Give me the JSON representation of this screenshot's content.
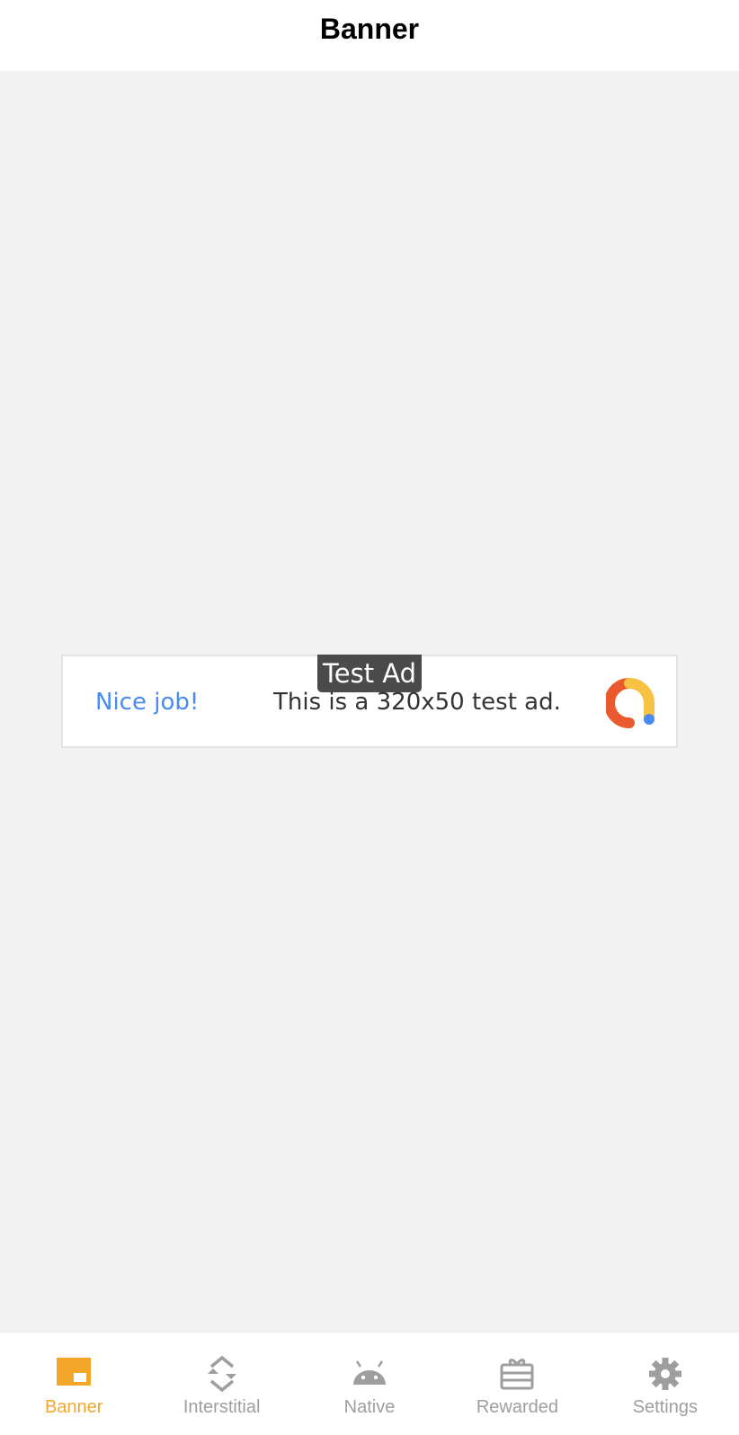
{
  "header": {
    "title": "Banner"
  },
  "ad": {
    "badge": "Test Ad",
    "headline": "Nice job!",
    "body": "This is a 320x50 test ad.",
    "colors": {
      "headline": "#4a8af4",
      "logo_red": "#ea5a2e",
      "logo_yellow": "#f7c244",
      "logo_blue": "#4a8af4"
    }
  },
  "bottom_nav": {
    "active_color": "#f4a62a",
    "inactive_color": "#9e9e9e",
    "items": [
      {
        "label": "Banner",
        "icon": "banner-icon",
        "active": true
      },
      {
        "label": "Interstitial",
        "icon": "interstitial-icon",
        "active": false
      },
      {
        "label": "Native",
        "icon": "android-icon",
        "active": false
      },
      {
        "label": "Rewarded",
        "icon": "gift-card-icon",
        "active": false
      },
      {
        "label": "Settings",
        "icon": "gear-icon",
        "active": false
      }
    ]
  }
}
